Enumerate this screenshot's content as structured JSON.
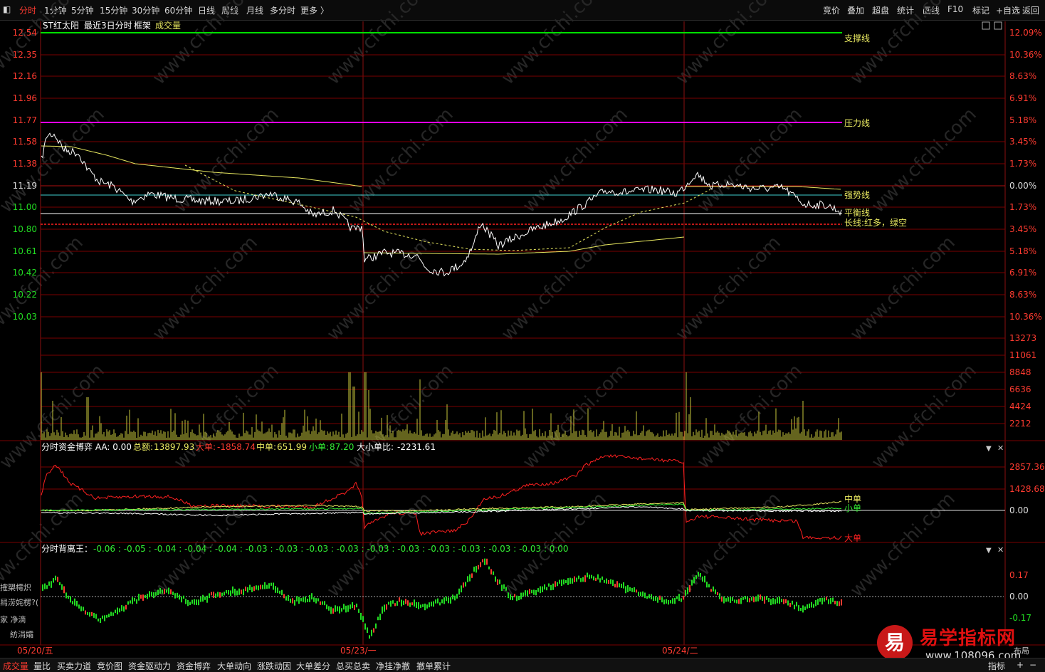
{
  "toolbar": {
    "left_items": [
      "分时",
      "1分钟",
      "5分钟",
      "15分钟",
      "30分钟",
      "60分钟",
      "日线",
      "周线",
      "月线",
      "多分时",
      "更多 〉"
    ],
    "active_index": 0,
    "right_items": [
      "竞价",
      "叠加",
      "超盘",
      "统计",
      "画线",
      "F10",
      "标记",
      "+自选",
      "返回"
    ]
  },
  "main_chart": {
    "title": "ST红太阳",
    "subtitle": "最近3日分时",
    "frame_label": "框架",
    "volume_label": "成交量",
    "price_ticks": [
      "12.54",
      "12.35",
      "12.16",
      "11.96",
      "11.77",
      "11.58",
      "11.38",
      "11.19",
      "11.00",
      "10.80",
      "10.61",
      "10.42",
      "10.22",
      "10.03"
    ],
    "pct_ticks": [
      "12.09%",
      "10.36%",
      "8.63%",
      "6.91%",
      "5.18%",
      "3.45%",
      "1.73%",
      "0.00%",
      "1.73%",
      "3.45%",
      "5.18%",
      "6.91%",
      "8.63%",
      "10.36%"
    ],
    "volume_ticks": [
      "13273",
      "11061",
      "8848",
      "6636",
      "4424",
      "2212"
    ],
    "line_labels": {
      "support": "支撑线",
      "pressure": "压力线",
      "strong": "强势线",
      "balance": "平衡线",
      "long": "长线:红多，绿空"
    },
    "date_labels": [
      "05/20/五",
      "05/23/一",
      "05/24/二"
    ]
  },
  "capital_panel": {
    "title": "分时资金博弈 AA: 0.00",
    "total_label": "总额:",
    "total_value": "13897.93",
    "large_label": "大单:",
    "large_value": "-1858.74",
    "mid_label": "中单:",
    "mid_value": "651.99",
    "small_label": "小单:",
    "small_value": "87.20",
    "ratio_label": "大小单比:",
    "ratio_value": "-2231.61",
    "ticks": [
      "2857.36",
      "1428.68",
      "0.00"
    ],
    "series_labels": {
      "mid": "中单",
      "small": "小单",
      "large": "大单"
    }
  },
  "divergence_panel": {
    "title": "分时背离王：",
    "values": "-0.06 : -0.05 : -0.04 : -0.04 : -0.04 : -0.03 : -0.03 : -0.03 : -0.03 : -0.03 : -0.03 : -0.03 : -0.03 : -0.03 : -0.03 : 0.00",
    "ticks": [
      "0.17",
      "0.00",
      "-0.17"
    ],
    "side_garbled": [
      "搉槊樗炽",
      "舄涝姹楞?(",
      "家  净滴",
      "紡涓孀"
    ]
  },
  "bottom_tabs": [
    "成交量",
    "量比",
    "买卖力道",
    "竞价图",
    "资金驱动力",
    "资金博弈",
    "大单动向",
    "涨跌动因",
    "大单差分",
    "总买总卖",
    "净挂净撤",
    "撤单累计"
  ],
  "bottom_active": 0,
  "bottom_right": {
    "indicator": "指标",
    "layout": "布局"
  },
  "watermark": "www.cfchi.com",
  "logo": {
    "badge": "易",
    "title": "易学指标网",
    "url": "www.108096.com"
  },
  "colors": {
    "up": "#ff3b30",
    "down": "#22dd22",
    "support": "#00e000",
    "pressure": "#ff00ff",
    "strong": "#40d0d0",
    "balance": "#ffffff",
    "long": "#ff2020",
    "grid": "#7a0000",
    "price": "#ffffff",
    "avg": "#e8e860",
    "volume": "#c8c83c",
    "mid": "#e8e860",
    "small": "#33ee33",
    "large": "#ff2020"
  }
}
